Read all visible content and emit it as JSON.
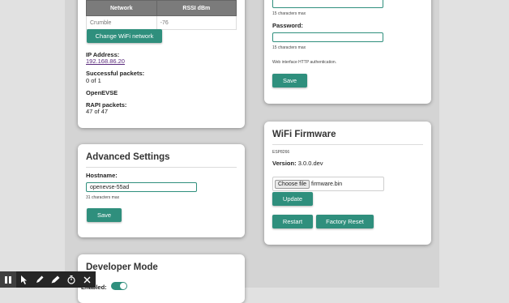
{
  "wifi_panel": {
    "table_headers": [
      "Network",
      "RSSI dBm"
    ],
    "networks": [
      {
        "name": "Crumble",
        "rssi": "-76"
      }
    ],
    "change_wifi_label": "Change WiFi network",
    "ip_label": "IP Address:",
    "ip_value": "192.168.86.20",
    "packets_label": "Successful packets:",
    "packets_value": "0 of 1",
    "openevse_label": "OpenEVSE",
    "rapi_label": "RAPI packets:",
    "rapi_value": "47 of 47"
  },
  "auth_panel": {
    "username_hint": "15 characters max",
    "password_label": "Password:",
    "password_hint": "15 characters max",
    "auth_note": "Web interface HTTP authentication.",
    "save_label": "Save"
  },
  "advanced_panel": {
    "title": "Advanced Settings",
    "hostname_label": "Hostname:",
    "hostname_value": "openevse-55ad",
    "hostname_hint": "31 characters max",
    "save_label": "Save"
  },
  "firmware_panel": {
    "title": "WiFi Firmware",
    "chip": "ESP8266",
    "version_label": "Version:",
    "version_value": "3.0.0.dev",
    "choose_file_label": "Choose file",
    "file_name": "firmware.bin",
    "update_label": "Update",
    "restart_label": "Restart",
    "factory_reset_label": "Factory Reset"
  },
  "developer_panel": {
    "title": "Developer Mode",
    "enabled_label": "Enabled:",
    "enabled": true
  },
  "toolbar": {
    "icons": [
      "pause-icon",
      "cursor-icon",
      "pen-icon",
      "marker-icon",
      "timer-icon",
      "close-icon"
    ]
  }
}
